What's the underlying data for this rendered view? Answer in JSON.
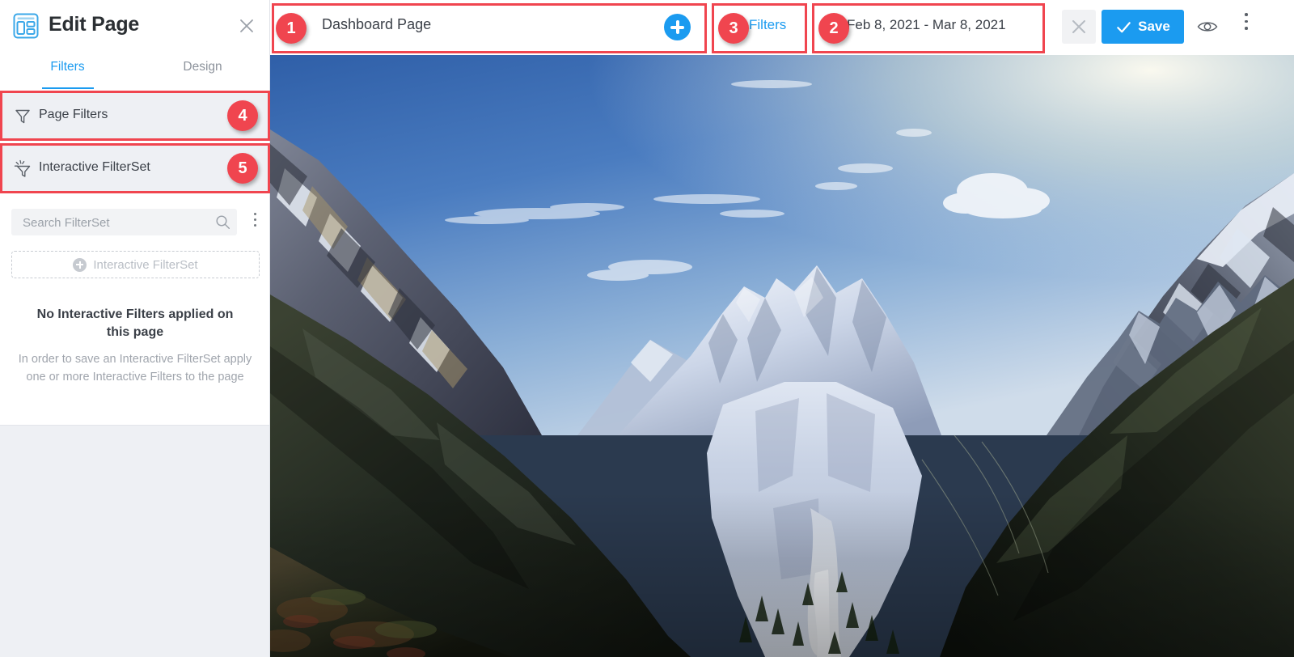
{
  "sidebar": {
    "logo_icon": "dashboard-layout-icon",
    "title": "Edit Page",
    "close_icon": "close-icon",
    "tabs": [
      {
        "label": "Filters",
        "active": true
      },
      {
        "label": "Design",
        "active": false
      }
    ],
    "filter_rows": [
      {
        "label": "Page Filters",
        "icon": "funnel-icon"
      },
      {
        "label": "Interactive FilterSet",
        "icon": "interactive-funnel-icon"
      }
    ],
    "search": {
      "placeholder": "Search FilterSet",
      "value": "",
      "icon": "search-icon"
    },
    "kebab_icon": "more-vertical-icon",
    "add_filterset": {
      "label": "Interactive FilterSet",
      "icon": "plus-circle-icon"
    },
    "empty_state": {
      "title": "No Interactive Filters applied on this page",
      "subtitle": "In order to save an Interactive FilterSet apply one or more Interactive Filters to the page"
    }
  },
  "topbar": {
    "dashboard_title": "Dashboard Page",
    "add_icon": "plus-circle-blue-icon",
    "filters_link": "Filters",
    "date_range": "Feb 8, 2021 - Mar 8, 2021",
    "close_icon": "close-icon",
    "save_label": "Save",
    "save_check_icon": "check-icon",
    "preview_icon": "eye-icon",
    "kebab_icon": "more-vertical-icon"
  },
  "canvas": {
    "background_image_alt": "Snow-capped mountain valley with glacier and forested slopes"
  },
  "annotations": [
    {
      "id": "1",
      "target": "dashboard-title-field"
    },
    {
      "id": "2",
      "target": "date-range-field"
    },
    {
      "id": "3",
      "target": "filters-link"
    },
    {
      "id": "4",
      "target": "page-filters-row"
    },
    {
      "id": "5",
      "target": "interactive-filterset-row"
    }
  ],
  "colors": {
    "accent_blue": "#1b9bf0",
    "annotation_red": "#f0454f",
    "sidebar_bg": "#eef0f4",
    "text_dark": "#3b4048",
    "text_muted": "#a0a5ad"
  }
}
